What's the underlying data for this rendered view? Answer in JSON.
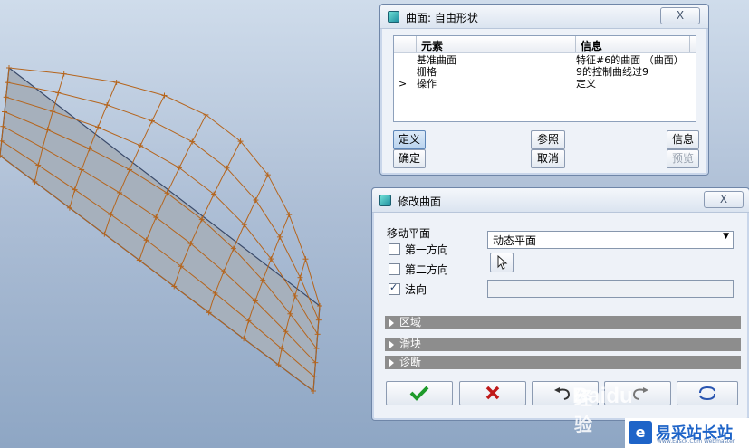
{
  "dialog1": {
    "title": "曲面: 自由形状",
    "close": "X",
    "columns": [
      "元素",
      "信息"
    ],
    "rows": [
      {
        "arrow": "",
        "element": "基准曲面",
        "info": "特征#6的曲面 （曲面）"
      },
      {
        "arrow": "",
        "element": "栅格",
        "info": "9的控制曲线过9"
      },
      {
        "arrow": ">",
        "element": "操作",
        "info": "定义"
      }
    ],
    "buttons": {
      "define": "定义",
      "ref": "参照",
      "info": "信息",
      "ok": "确定",
      "cancel": "取消",
      "preview": "预览"
    }
  },
  "dialog2": {
    "title": "修改曲面",
    "close": "X",
    "group_label": "移动平面",
    "dropdown_value": "动态平面",
    "options": [
      {
        "label": "第一方向",
        "checked": false
      },
      {
        "label": "第二方向",
        "checked": false
      },
      {
        "label": "法向",
        "checked": true
      }
    ],
    "sections": [
      "区域",
      "滑块",
      "诊断"
    ]
  },
  "watermark": {
    "baidu": "Baidu",
    "jingyan": "经验",
    "site": "易采站长站",
    "site_sub": "Www.Easck.Com Webmaster"
  },
  "colors": {
    "mesh": "#b5651d",
    "surface": "#a9b3bf",
    "accent_ok": "#1e9a2a",
    "accent_cancel": "#c01a1a"
  }
}
